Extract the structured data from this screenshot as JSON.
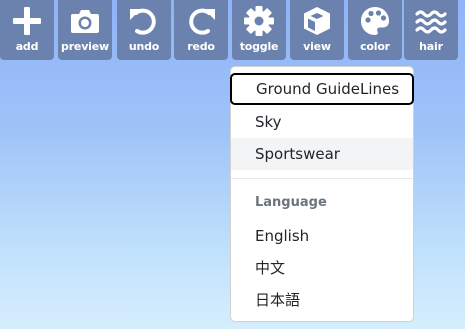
{
  "toolbar": {
    "buttons": [
      {
        "label": "add",
        "icon": "plus-icon"
      },
      {
        "label": "preview",
        "icon": "camera-icon"
      },
      {
        "label": "undo",
        "icon": "undo-icon"
      },
      {
        "label": "redo",
        "icon": "redo-icon"
      },
      {
        "label": "toggle",
        "icon": "gear-icon"
      },
      {
        "label": "view",
        "icon": "cube-icon"
      },
      {
        "label": "color",
        "icon": "palette-icon"
      },
      {
        "label": "hair",
        "icon": "waves-icon"
      }
    ]
  },
  "menu": {
    "items": [
      {
        "label": "Ground GuideLines",
        "state": "focused"
      },
      {
        "label": "Sky",
        "state": "normal"
      },
      {
        "label": "Sportswear",
        "state": "hover"
      }
    ],
    "language_header": "Language",
    "languages": [
      {
        "label": "English"
      },
      {
        "label": "中文"
      },
      {
        "label": "日本語"
      }
    ]
  },
  "colors": {
    "toolbar_button_bg": "#6b82ae",
    "toolbar_icon": "#ffffff",
    "menu_bg": "#ffffff",
    "menu_hover": "#f3f4f6",
    "menu_focus_outline": "#000000",
    "header_text": "#6c757d",
    "sky_top": "#8fb3f7",
    "sky_bottom": "#d6eefc"
  }
}
